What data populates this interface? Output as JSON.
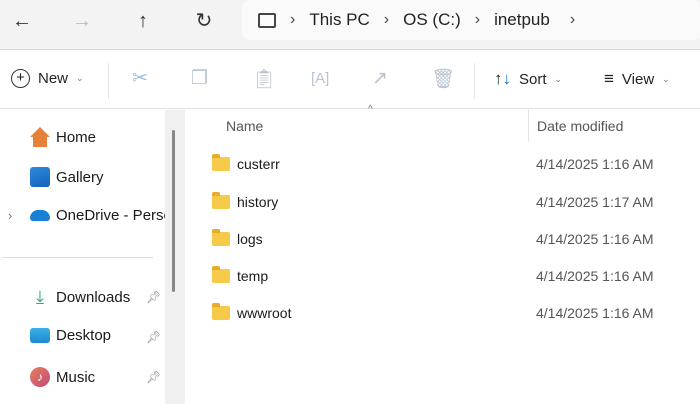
{
  "nav": {
    "back": "←",
    "forward": "→",
    "up": "↑",
    "refresh": "↻"
  },
  "address": {
    "crumbs": [
      "This PC",
      "OS (C:)",
      "inetpub"
    ]
  },
  "toolbar": {
    "new_label": "New",
    "sort_label": "Sort",
    "view_label": "View"
  },
  "sidebar": {
    "items": [
      {
        "label": "Home"
      },
      {
        "label": "Gallery"
      },
      {
        "label": "OneDrive - Personal"
      },
      {
        "label": "Downloads"
      },
      {
        "label": "Desktop"
      },
      {
        "label": "Music"
      }
    ]
  },
  "columns": {
    "name": "Name",
    "date": "Date modified"
  },
  "files": [
    {
      "name": "custerr",
      "date": "4/14/2025 1:16 AM"
    },
    {
      "name": "history",
      "date": "4/14/2025 1:17 AM"
    },
    {
      "name": "logs",
      "date": "4/14/2025 1:16 AM"
    },
    {
      "name": "temp",
      "date": "4/14/2025 1:16 AM"
    },
    {
      "name": "wwwroot",
      "date": "4/14/2025 1:16 AM"
    }
  ]
}
